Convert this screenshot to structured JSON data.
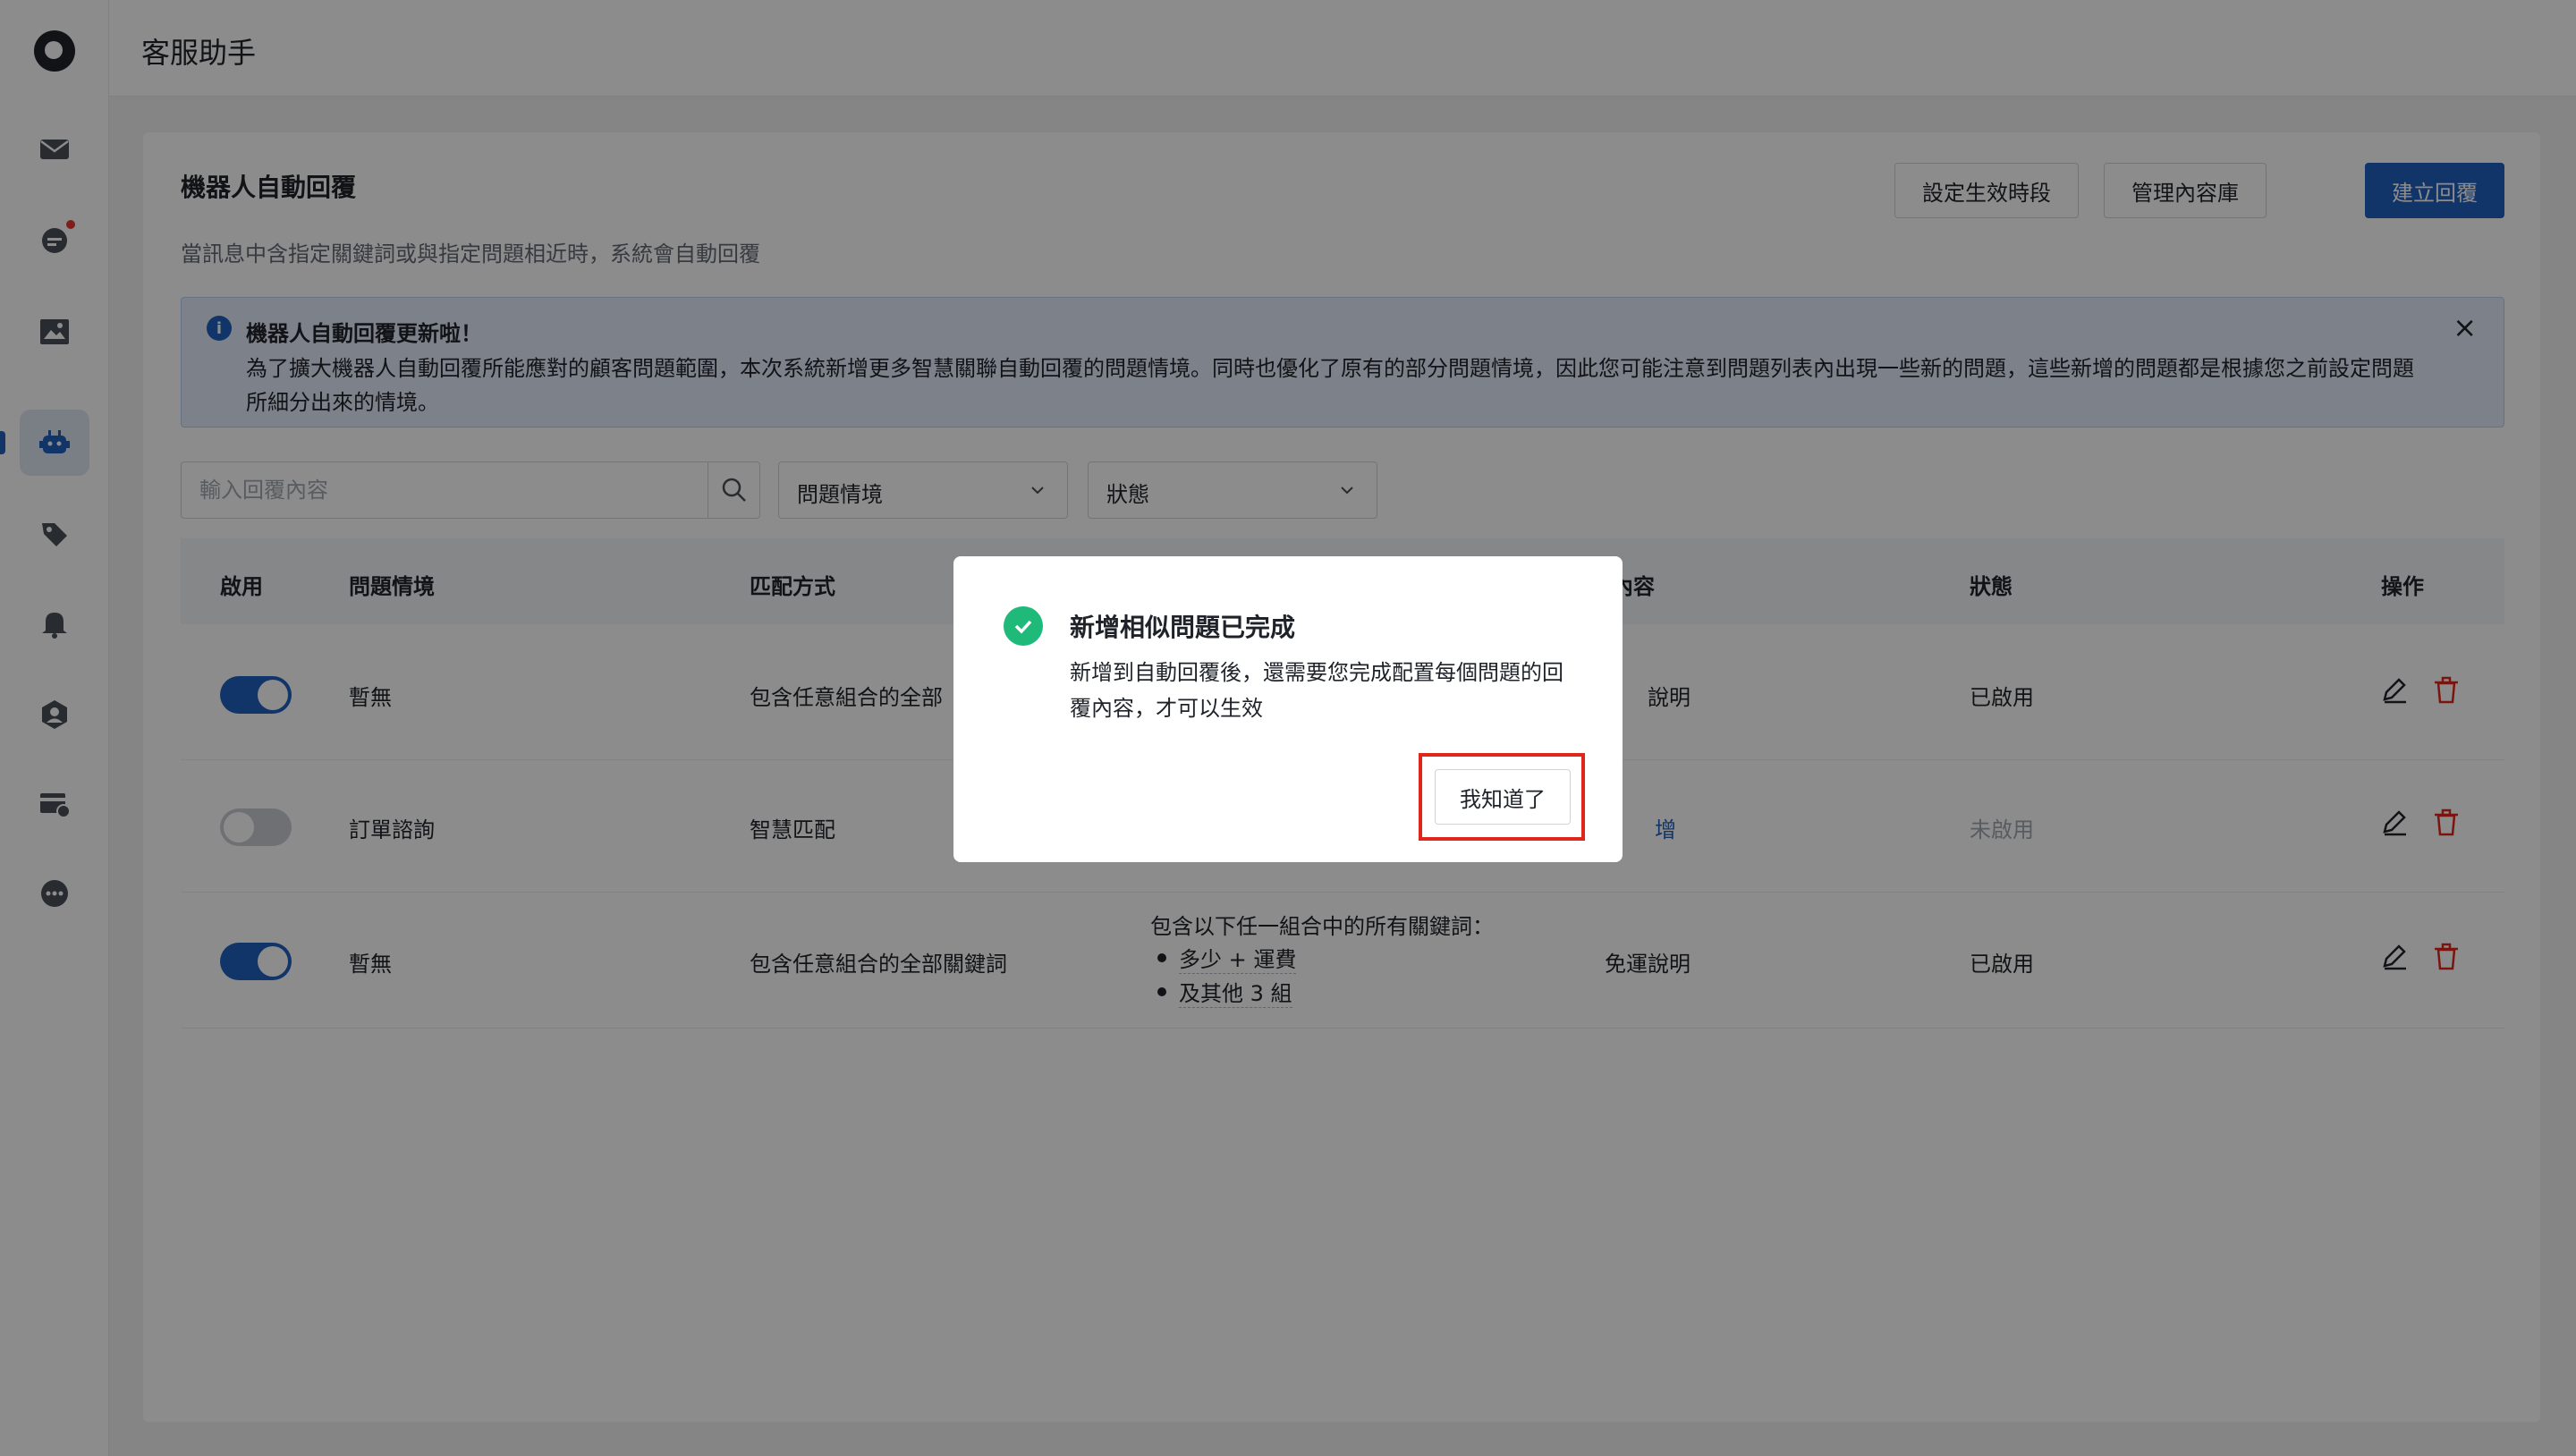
{
  "app": {
    "title": "客服助手"
  },
  "sidebar": {
    "items": [
      {
        "name": "mail-icon"
      },
      {
        "name": "chat-icon",
        "badge": true
      },
      {
        "name": "image-icon"
      },
      {
        "name": "robot-icon",
        "active": true
      },
      {
        "name": "tag-icon"
      },
      {
        "name": "bell-icon"
      },
      {
        "name": "agent-icon"
      },
      {
        "name": "card-settings-icon"
      },
      {
        "name": "more-icon"
      }
    ]
  },
  "panel": {
    "title": "機器人自動回覆",
    "description": "當訊息中含指定關鍵詞或與指定問題相近時，系統會自動回覆",
    "buttons": {
      "schedule": "設定生效時段",
      "library": "管理內容庫",
      "create": "建立回覆"
    }
  },
  "alert": {
    "title": "機器人自動回覆更新啦！",
    "body": "為了擴大機器人自動回覆所能應對的顧客問題範圍，本次系統新增更多智慧關聯自動回覆的問題情境。同時也優化了原有的部分問題情境，因此您可能注意到問題列表內出現一些新的問題，這些新增的問題都是根據您之前設定問題所細分出來的情境。",
    "close": "×"
  },
  "filters": {
    "search_placeholder": "輸入回覆內容",
    "scenario": "問題情境",
    "status": "狀態"
  },
  "table": {
    "headers": {
      "enabled": "啟用",
      "scenario": "問題情境",
      "match": "匹配方式",
      "keywords": "",
      "content": "內容",
      "status": "狀態",
      "actions": "操作"
    },
    "rows": [
      {
        "enabled": true,
        "scenario": "暫無",
        "match": "包含任意組合的全部",
        "content": "說明",
        "status": "已啟用"
      },
      {
        "enabled": false,
        "scenario": "訂單諮詢",
        "match": "智慧匹配",
        "content": "增",
        "status": "未啟用"
      },
      {
        "enabled": true,
        "scenario": "暫無",
        "match": "包含任意組合的全部關鍵詞",
        "keywords_title": "包含以下任一組合中的所有關鍵詞：",
        "keyword_1": "多少 + 運費",
        "keyword_2": "及其他 3 組",
        "content": "免運說明",
        "status": "已啟用"
      }
    ]
  },
  "modal": {
    "title": "新增相似問題已完成",
    "body": "新增到自動回覆後，還需要您完成配置每個問題的回覆內容，才可以生效",
    "button": "我知道了"
  },
  "colors": {
    "primary": "#1f5fbf",
    "success": "#1fb97a",
    "danger": "#e0261b",
    "overlay": "rgba(0,0,0,0.45)"
  }
}
